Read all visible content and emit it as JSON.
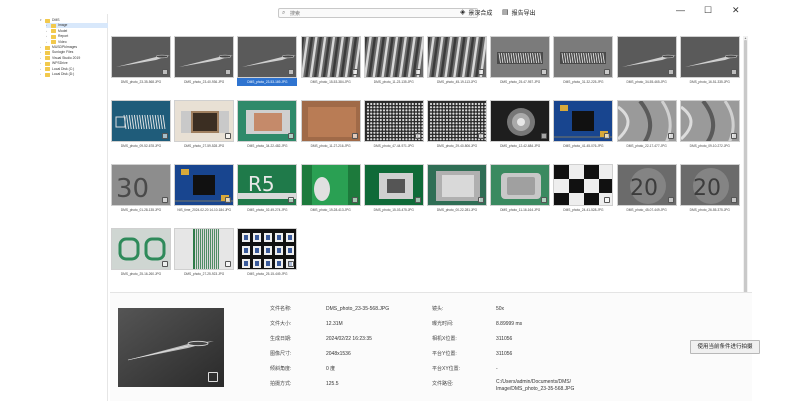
{
  "search": {
    "placeholder": "搜索"
  },
  "toolbar": {
    "merge_label": "景深合成",
    "export_label": "报告导出"
  },
  "window_controls": {
    "minimize": "—",
    "maximize": "☐",
    "close": "✕"
  },
  "tree": [
    {
      "label": "DMS",
      "level": 0,
      "expanded": true
    },
    {
      "label": "Image",
      "level": 1,
      "selected": true
    },
    {
      "label": "Model",
      "level": 1
    },
    {
      "label": "Report",
      "level": 1
    },
    {
      "label": "Video",
      "level": 1
    },
    {
      "label": "MUSDPkImages",
      "level": 0
    },
    {
      "label": "Sunlogin Files",
      "level": 0
    },
    {
      "label": "Visual Studio 2019",
      "level": 0
    },
    {
      "label": "WPSDrive",
      "level": 0
    },
    {
      "label": "Local Disk (C:)",
      "level": 0
    },
    {
      "label": "Local Disk (D:)",
      "level": 0
    }
  ],
  "thumbnails": [
    {
      "caption": "DMS_photo_23-35-568.JPG",
      "art": "needle"
    },
    {
      "caption": "DMS_photo_23-40-936.JPG",
      "art": "needle"
    },
    {
      "caption": "DMS_photo_23-53-169.JPG",
      "art": "needle",
      "selected": true
    },
    {
      "caption": "DMS_photo_15-53-384.JPG",
      "art": "thread"
    },
    {
      "caption": "DMS_photo_11-23-135.JPG",
      "art": "thread"
    },
    {
      "caption": "DMS_photo_45-19-113.JPG",
      "art": "thread"
    },
    {
      "caption": "DMS_photo_25-47-957.JPG",
      "art": "spring"
    },
    {
      "caption": "DMS_photo_31-32-225.JPG",
      "art": "spring"
    },
    {
      "caption": "DMS_photo_34-55-465.JPG",
      "art": "needle"
    },
    {
      "caption": "DMS_photo_16-51-335.JPG",
      "art": "needle"
    },
    {
      "caption": "DMS_photo_09-52-678.JPG",
      "art": "springblue"
    },
    {
      "caption": "DMS_photo_27-59-528.JPG",
      "art": "resistor"
    },
    {
      "caption": "DMS_photo_34-22-482.JPG",
      "art": "resistorgreen"
    },
    {
      "caption": "DMS_photo_11-27-216.JPG",
      "art": "copper"
    },
    {
      "caption": "DMS_photo_47-44-971.JPG",
      "art": "bga"
    },
    {
      "caption": "DMS_photo_29-40-806.JPG",
      "art": "bga"
    },
    {
      "caption": "DMS_photo_12-42-684.JPG",
      "art": "lens"
    },
    {
      "caption": "DMS_photo_41-45-076.JPG",
      "art": "pcb"
    },
    {
      "caption": "DMS_photo_22-17-477.JPG",
      "art": "coin"
    },
    {
      "caption": "DMS_photo_09-10-272.JPG",
      "art": "coin"
    },
    {
      "caption": "DMS_photo_01-28-135.JPG",
      "art": "coinnum"
    },
    {
      "caption": "NIS_time_2024-02-20 14-10-184.JPG",
      "art": "pcb"
    },
    {
      "caption": "DMS_photo_02-49-274.JPG",
      "art": "r5"
    },
    {
      "caption": "DMS_photo_19-28-413.JPG",
      "art": "greenpart"
    },
    {
      "caption": "DMS_photo_15-03-475.JPG",
      "art": "smd"
    },
    {
      "caption": "DMS_photo_00-22-281.JPG",
      "art": "chip"
    },
    {
      "caption": "DMS_photo_11-16-164.JPG",
      "art": "chipgreen"
    },
    {
      "caption": "DMS_photo_24-41-528.JPG",
      "art": "checker"
    },
    {
      "caption": "DMS_photo_45-07-449.JPG",
      "art": "coin20"
    },
    {
      "caption": "DMS_photo_26-55-375.JPG",
      "art": "coin20"
    },
    {
      "caption": "DMS_photo_25-16-260.JPG",
      "art": "glasses"
    },
    {
      "caption": "DMS_photo_27-25-923.JPG",
      "art": "ribbon"
    },
    {
      "caption": "DMS_photo_25-15-449.JPG",
      "art": "leds"
    }
  ],
  "info": {
    "labels": {
      "file_name": "文件名称:",
      "file_size": "文件大小:",
      "created": "生成日期:",
      "image_size": "图像尺寸:",
      "rotation": "倾斜角度:",
      "capture_mode": "拍摄方式:",
      "lens": "镜头:",
      "exposure": "曝光时间:",
      "x_pos": "相机X位置:",
      "y_pos": "平台Y位置:",
      "xy_pos": "平台XY位置:",
      "path": "文件路径:"
    },
    "values": {
      "file_name": "DMS_photo_23-35-568.JPG",
      "file_size": "12.31M",
      "created": "2024/02/22 16:23:35",
      "image_size": "2048x1536",
      "rotation": "0 度",
      "capture_mode": "125.5",
      "lens": "50x",
      "exposure": "8.89999 ms",
      "x_pos": "311056",
      "y_pos": "311056",
      "xy_pos": "-",
      "path_line1": "C:/Users/admin/Documents/DMS/",
      "path_line2": "Image/DMS_photo_23-35-568.JPG"
    },
    "action_label": "使用当前条件进行拍摄"
  }
}
